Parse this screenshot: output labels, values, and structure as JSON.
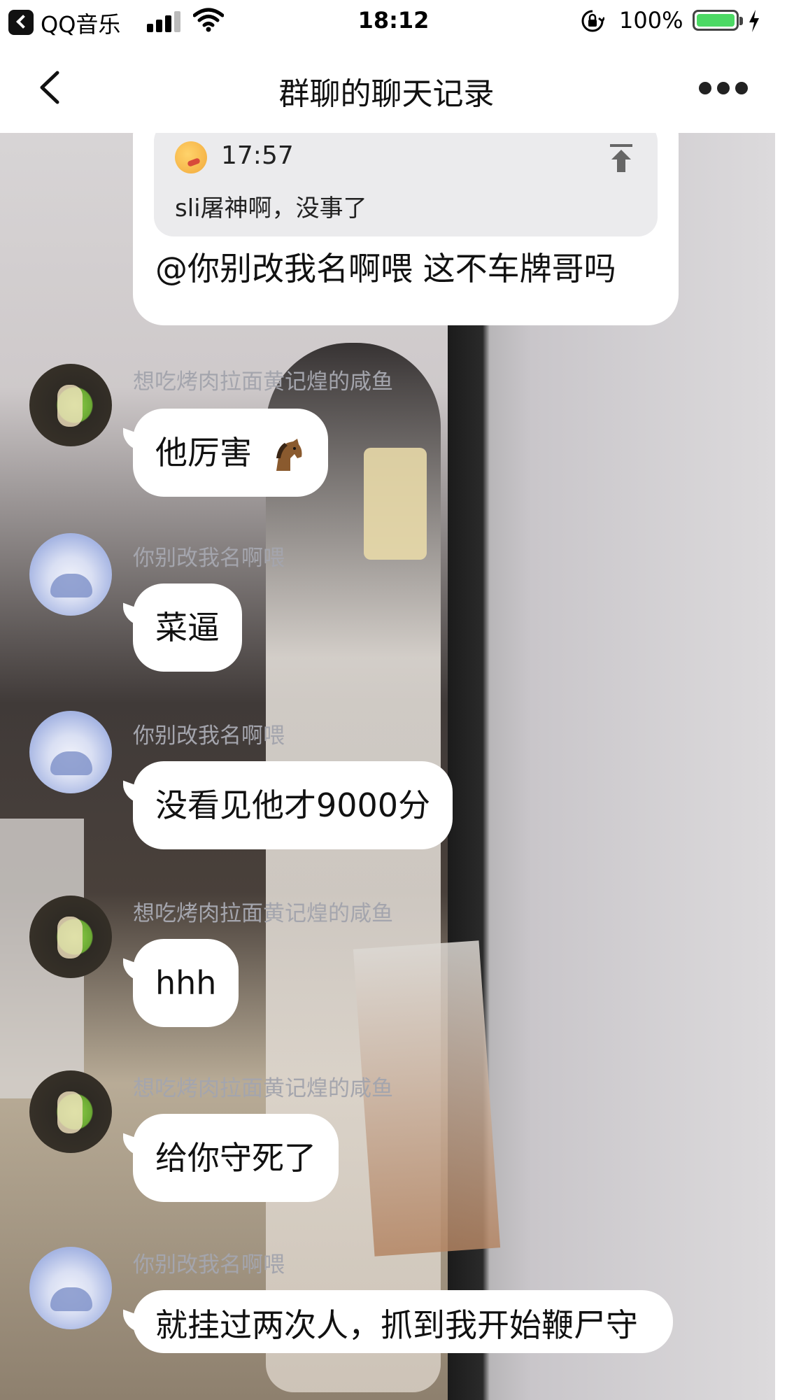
{
  "status_bar": {
    "back_app": "QQ音乐",
    "time": "18:12",
    "battery": "100%"
  },
  "nav": {
    "title": "群聊的聊天记录"
  },
  "quote": {
    "time": "17:57",
    "text": "sli屠神啊，没事了",
    "reply": "@你别改我名啊喂 这不车牌哥吗"
  },
  "messages": [
    {
      "sender": "想吃烤肉拉面黄记煌的咸鱼",
      "avatar": "green",
      "text": "他厉害",
      "emoji": "horse-icon"
    },
    {
      "sender": "你别改我名啊喂",
      "avatar": "blue",
      "text": "菜逼"
    },
    {
      "sender": "你别改我名啊喂",
      "avatar": "blue",
      "text": "没看见他才9000分"
    },
    {
      "sender": "想吃烤肉拉面黄记煌的咸鱼",
      "avatar": "green",
      "text": "hhh"
    },
    {
      "sender": "想吃烤肉拉面黄记煌的咸鱼",
      "avatar": "green",
      "text": "给你守死了"
    },
    {
      "sender": "你别改我名啊喂",
      "avatar": "blue",
      "text": "就挂过两次人，抓到我开始鞭尸守"
    }
  ],
  "colors": {
    "bubble": "#ffffff",
    "sender_name": "#a4a5ad",
    "battery": "#4cd964"
  }
}
